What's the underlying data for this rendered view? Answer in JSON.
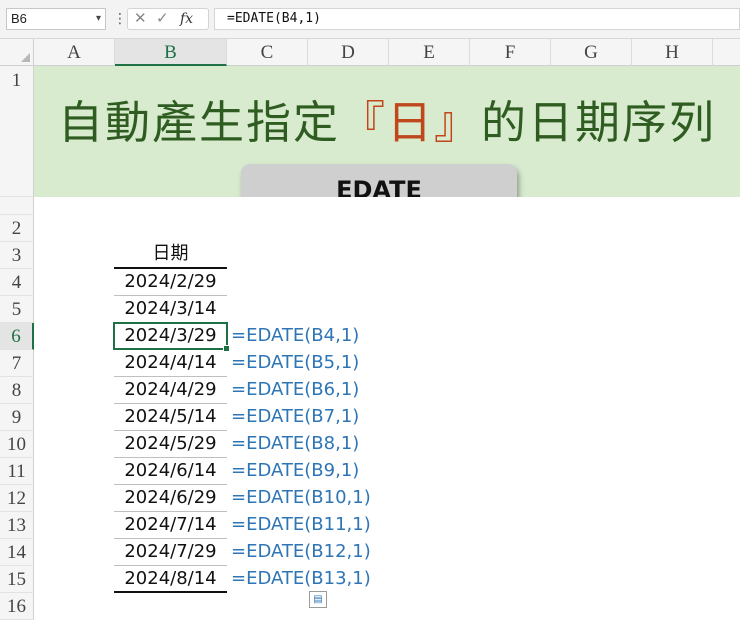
{
  "formula_bar": {
    "name_box": "B6",
    "cancel_icon": "✕",
    "enter_icon": "✓",
    "fx_label": "fx",
    "formula": "=EDATE(B4,1)"
  },
  "columns": [
    "A",
    "B",
    "C",
    "D",
    "E",
    "F",
    "G",
    "H"
  ],
  "selected_column": "B",
  "rows": [
    "1",
    "2",
    "3",
    "4",
    "5",
    "6",
    "7",
    "8",
    "9",
    "10",
    "11",
    "12",
    "13",
    "14",
    "15",
    "16"
  ],
  "selected_row": "6",
  "banner": {
    "title_before": "自動產生指定",
    "title_highlight": "『日』",
    "title_after": "的日期序列",
    "button_label": "EDATE"
  },
  "table": {
    "header": "日期",
    "dates": [
      "2024/2/29",
      "2024/3/14",
      "2024/3/29",
      "2024/4/14",
      "2024/4/29",
      "2024/5/14",
      "2024/5/29",
      "2024/6/14",
      "2024/6/29",
      "2024/7/14",
      "2024/7/29",
      "2024/8/14"
    ],
    "formulas": [
      "",
      "",
      "=EDATE(B4,1)",
      "=EDATE(B5,1)",
      "=EDATE(B6,1)",
      "=EDATE(B7,1)",
      "=EDATE(B8,1)",
      "=EDATE(B9,1)",
      "=EDATE(B10,1)",
      "=EDATE(B11,1)",
      "=EDATE(B12,1)",
      "=EDATE(B13,1)"
    ]
  },
  "colors": {
    "accent_green": "#1e7145",
    "banner_bg": "#d8ebcf",
    "title_green": "#2f5d21",
    "title_highlight": "#c0471c",
    "formula_blue": "#2e75b6"
  }
}
